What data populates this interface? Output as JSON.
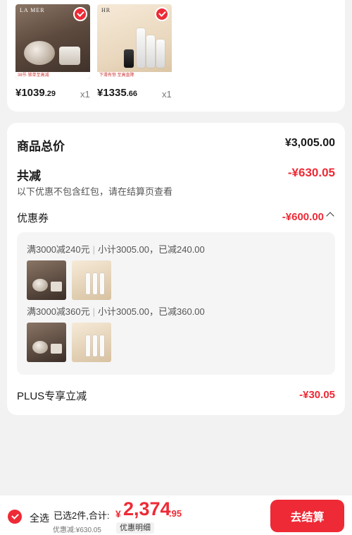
{
  "products": [
    {
      "brand": "LA MER",
      "banner": "38节·锁单至高减",
      "price_main": "¥1039",
      "price_dec": ".29",
      "qty": "x1"
    },
    {
      "brand": "HR",
      "banner": "下滑有惊 至高直降",
      "price_main": "¥1335",
      "price_dec": ".66",
      "qty": "x1"
    }
  ],
  "summary": {
    "total_label": "商品总价",
    "total_value": "¥3,005.00",
    "discount_label": "共减",
    "discount_value": "-¥630.05",
    "discount_note": "以下优惠不包含红包，请在结算页查看",
    "coupon_label": "优惠券",
    "coupon_value": "-¥600.00",
    "coupons": [
      {
        "rule": "满3000减240元",
        "detail": "小计3005.00，已减240.00"
      },
      {
        "rule": "满3000减360元",
        "detail": "小计3005.00，已减360.00"
      }
    ],
    "plus_label": "PLUS专享立减",
    "plus_value": "-¥30.05"
  },
  "bottom": {
    "select_all": "全选",
    "selected_count": "已选2件,合计:",
    "total_symbol": "¥",
    "total_main": "2,374",
    "total_dec": ".95",
    "discount_sum": "优惠减:¥630.05",
    "detail_button": "优惠明细",
    "checkout_button": "去结算"
  },
  "colors": {
    "accent": "#ee2a36",
    "background": "#f2f2f2"
  }
}
